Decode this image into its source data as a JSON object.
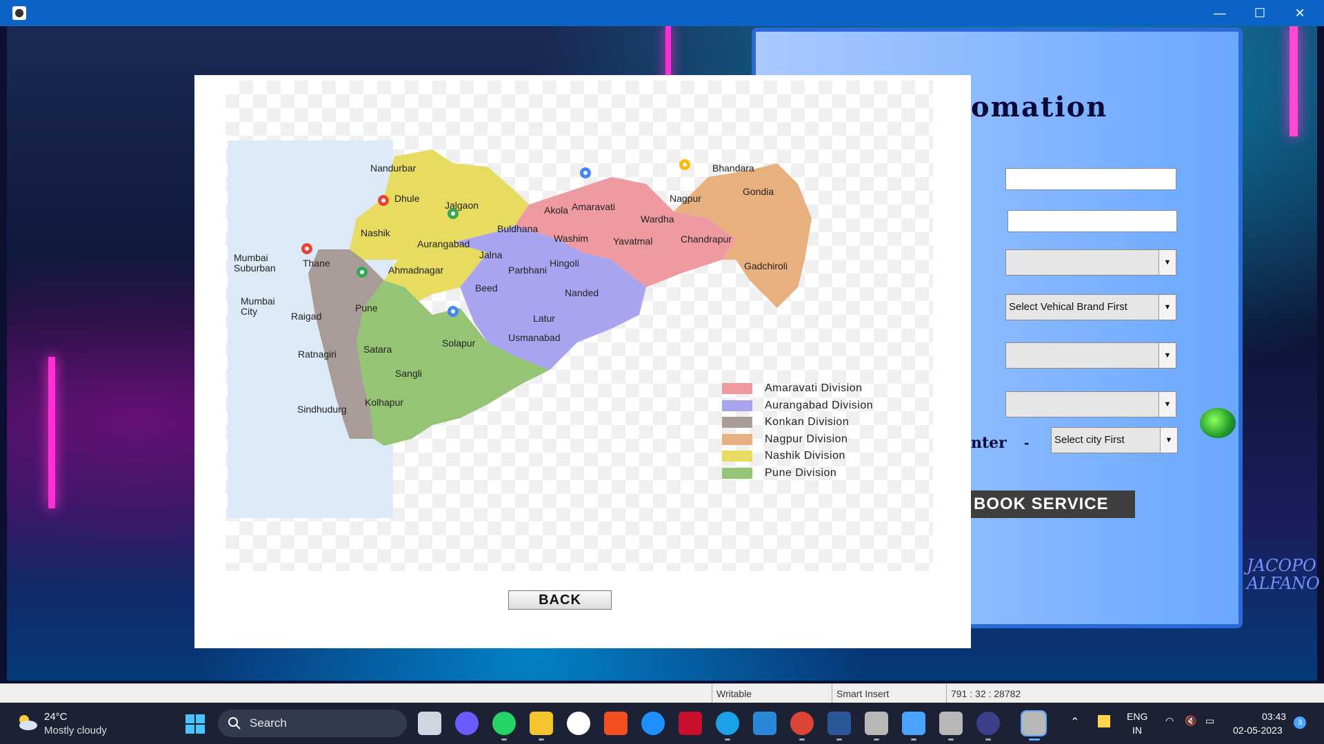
{
  "window": {
    "controls": {
      "minimize": "—",
      "maximize": "☐",
      "close": "✕"
    }
  },
  "form": {
    "heading_fragment": "omation",
    "brand_placeholder": "Select Vehical Brand First",
    "center_label_fragment": "nter",
    "center_separator": "-",
    "city_placeholder": "Select city First",
    "book_button": "BOOK SERVICE",
    "signature_line1": "JACOPO",
    "signature_line2": "ALFANO"
  },
  "dialog": {
    "back_button": "BACK",
    "map_labels": {
      "nandurbar": "Nandurbar",
      "dhule": "Dhule",
      "jalgaon": "Jalgaon",
      "nashik": "Nashik",
      "aurangabad": "Aurangabad",
      "jalna": "Jalna",
      "ahmadnagar": "Ahmadnagar",
      "beed": "Beed",
      "parbhani": "Parbhani",
      "hingoli": "Hingoli",
      "nanded": "Nanded",
      "latur": "Latur",
      "usmanabad": "Usmanabad",
      "solapur": "Solapur",
      "pune": "Pune",
      "satara": "Satara",
      "sangli": "Sangli",
      "kolhapur": "Kolhapur",
      "sindhudurg": "Sindhudurg",
      "ratnagiri": "Ratnagiri",
      "raigad": "Raigad",
      "mumbai_city": "Mumbai\nCity",
      "mumbai_suburban": "Mumbai\nSuburban",
      "thane": "Thane",
      "buldhana": "Buldhana",
      "akola": "Akola",
      "washim": "Washim",
      "amaravati": "Amaravati",
      "yavatmal": "Yavatmal",
      "wardha": "Wardha",
      "nagpur": "Nagpur",
      "bhandara": "Bhandara",
      "gondia": "Gondia",
      "chandrapur": "Chandrapur",
      "gadchiroli": "Gadchiroli"
    },
    "legend": [
      {
        "label": "Amaravati Division",
        "color": "#ef9aa0"
      },
      {
        "label": "Aurangabad Division",
        "color": "#a9a4f0"
      },
      {
        "label": "Konkan Division",
        "color": "#a99c98"
      },
      {
        "label": "Nagpur Division",
        "color": "#e8b07e"
      },
      {
        "label": "Nashik Division",
        "color": "#e8dc60"
      },
      {
        "label": "Pune Division",
        "color": "#95c474"
      }
    ]
  },
  "statusbar": {
    "mode": "Writable",
    "insert": "Smart Insert",
    "position": "791 : 32 : 28782"
  },
  "taskbar": {
    "weather_temp": "24°C",
    "weather_desc": "Mostly cloudy",
    "search_label": "Search",
    "tray_lang_1": "ENG",
    "tray_lang_2": "IN",
    "clock_time": "03:43",
    "clock_date": "02-05-2023",
    "notification_count": "3"
  }
}
